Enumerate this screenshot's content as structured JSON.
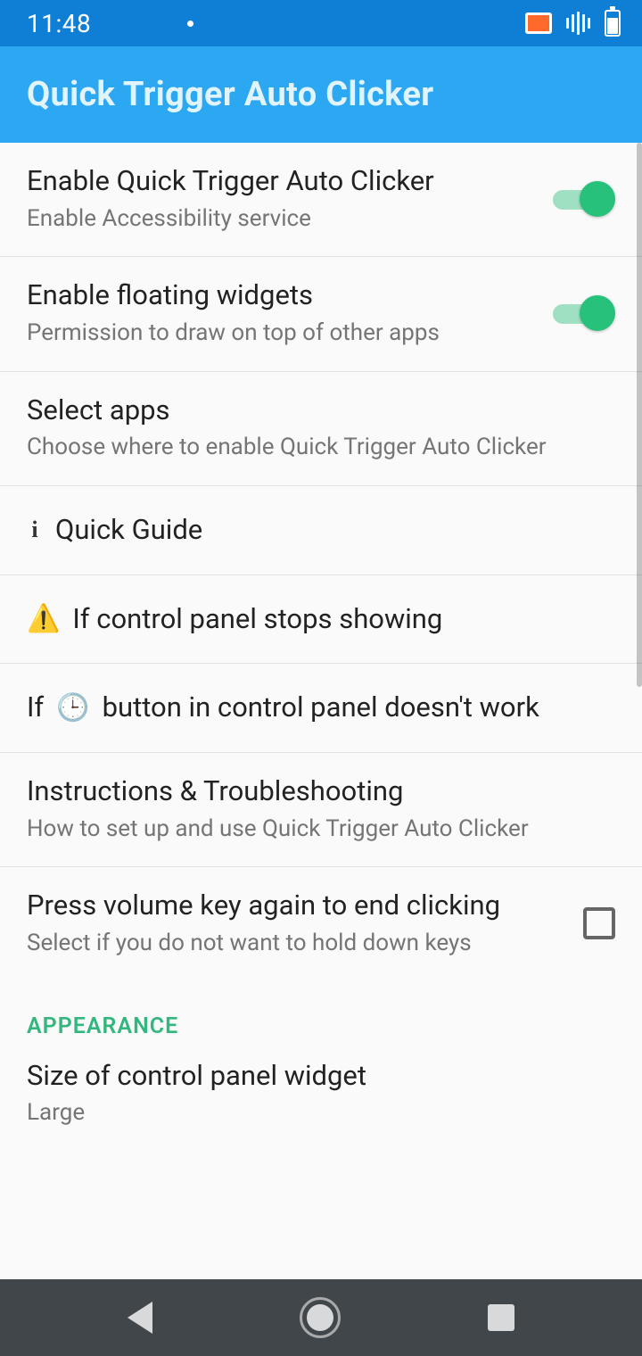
{
  "status": {
    "time": "11:48"
  },
  "app": {
    "title": "Quick Trigger Auto Clicker"
  },
  "rows": {
    "enable": {
      "title": "Enable Quick Trigger Auto Clicker",
      "sub": "Enable Accessibility service",
      "on": true
    },
    "floating": {
      "title": "Enable floating widgets",
      "sub": "Permission to draw on top of other apps",
      "on": true
    },
    "selectApps": {
      "title": "Select apps",
      "sub": "Choose where to enable Quick Trigger Auto Clicker"
    },
    "quickGuide": {
      "title": "Quick Guide"
    },
    "panelStops": {
      "title": "If control panel stops showing"
    },
    "clockBtn": {
      "prefix": "If ",
      "suffix": " button in control panel doesn't work"
    },
    "instructions": {
      "title": "Instructions & Troubleshooting",
      "sub": "How to set up and use Quick Trigger Auto Clicker"
    },
    "volumeKey": {
      "title": "Press volume key again to end clicking",
      "sub": "Select if you do not want to hold down keys",
      "checked": false
    },
    "sizeWidget": {
      "title": "Size of control panel widget",
      "sub": "Large"
    }
  },
  "sections": {
    "appearance": "APPEARANCE"
  }
}
